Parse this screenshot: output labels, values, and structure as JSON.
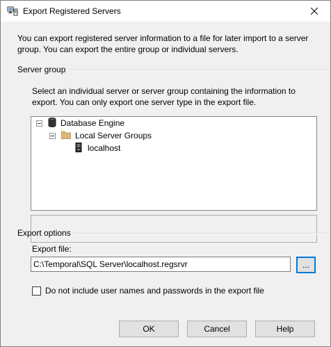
{
  "window": {
    "title": "Export Registered Servers"
  },
  "intro_text": "You can export registered server information to a file for later import to a server group. You can export the entire group or individual servers.",
  "server_group": {
    "label": "Server group",
    "instructions": "Select an individual server or server group containing the information to export. You can only export one server type in the export file.",
    "tree": [
      {
        "label": "Database Engine",
        "icon": "database-cylinder-icon",
        "expanded": true
      },
      {
        "label": "Local Server Groups",
        "icon": "folder-icon",
        "expanded": true
      },
      {
        "label": "localhost",
        "icon": "server-tower-icon",
        "selected": true
      }
    ]
  },
  "export_options": {
    "label": "Export options",
    "export_file_label": "Export file:",
    "export_file_value": "C:\\Temporal\\SQL Server\\localhost.regsrvr",
    "browse_label": "...",
    "checkbox_label": "Do not include user names and passwords in the export file",
    "checkbox_checked": false
  },
  "buttons": {
    "ok": "OK",
    "cancel": "Cancel",
    "help": "Help"
  },
  "colors": {
    "dialog_background": "#f0f0f0",
    "focus_border": "#0078d7",
    "folder": "#dcb67a"
  }
}
